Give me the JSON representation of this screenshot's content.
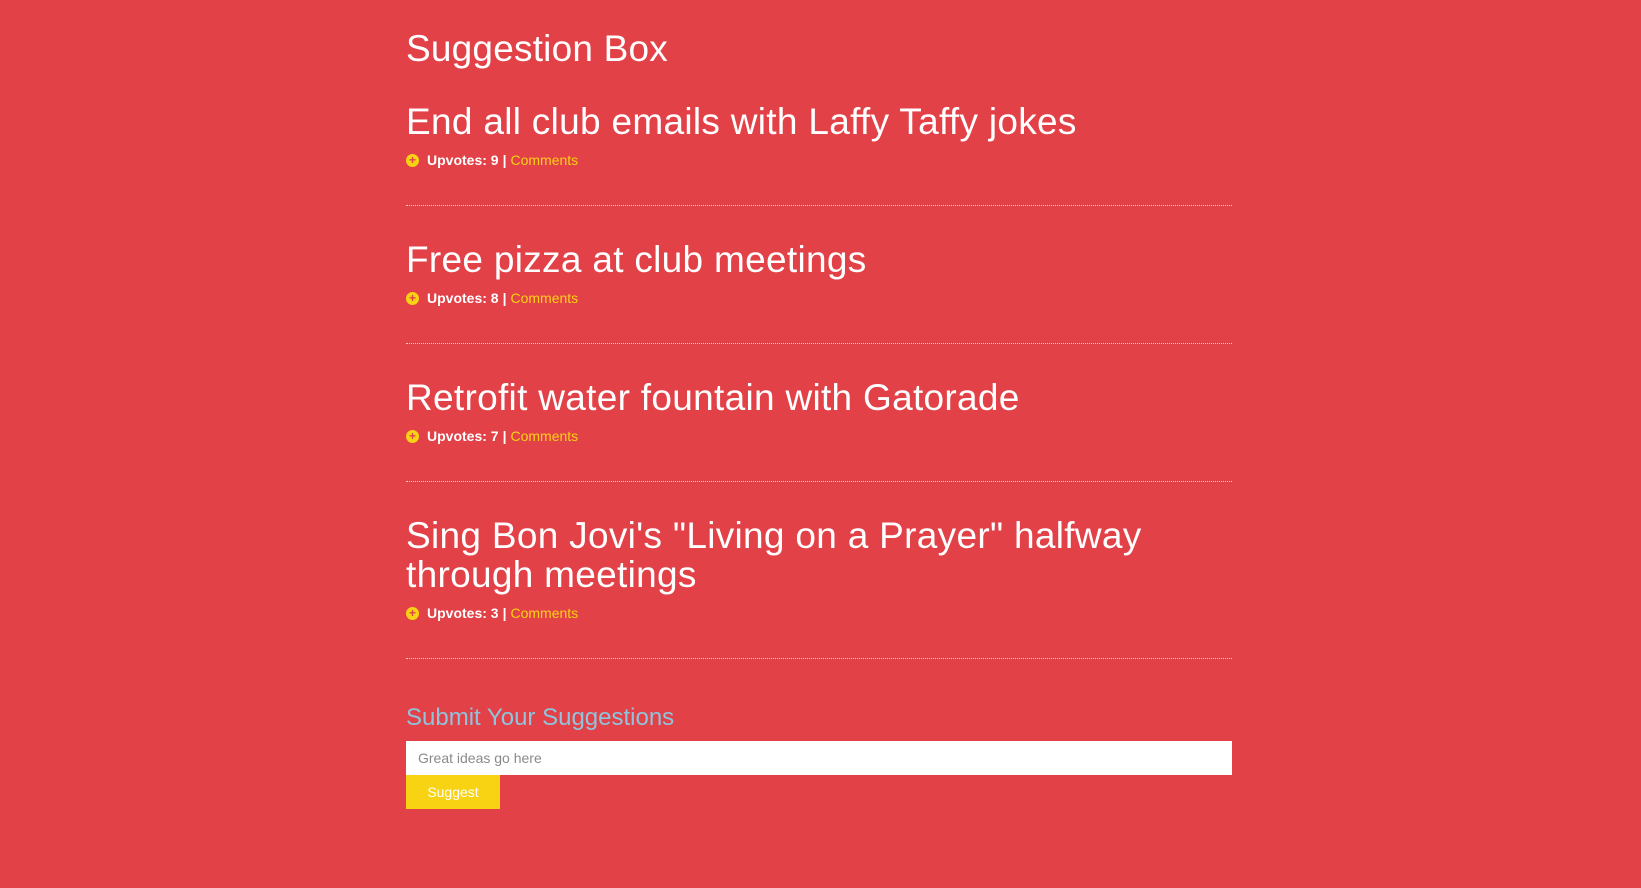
{
  "page": {
    "title": "Suggestion Box"
  },
  "suggestions": [
    {
      "title": "End all club emails with Laffy Taffy jokes",
      "upvotes_label": "Upvotes: 9",
      "comments_label": "Comments"
    },
    {
      "title": "Free pizza at club meetings",
      "upvotes_label": "Upvotes: 8",
      "comments_label": "Comments"
    },
    {
      "title": "Retrofit water fountain with Gatorade",
      "upvotes_label": "Upvotes: 7",
      "comments_label": "Comments"
    },
    {
      "title": "Sing Bon Jovi's \"Living on a Prayer\" halfway through meetings",
      "upvotes_label": "Upvotes: 3",
      "comments_label": "Comments"
    }
  ],
  "separator": "|",
  "icons": {
    "upvote": "plus-circle-icon"
  },
  "form": {
    "heading": "Submit Your Suggestions",
    "input_placeholder": "Great ideas go here",
    "input_value": "",
    "button_label": "Suggest"
  },
  "colors": {
    "background": "#e24147",
    "accent": "#f8d313",
    "form_heading": "#8fc4dc",
    "text": "#ffffff"
  }
}
